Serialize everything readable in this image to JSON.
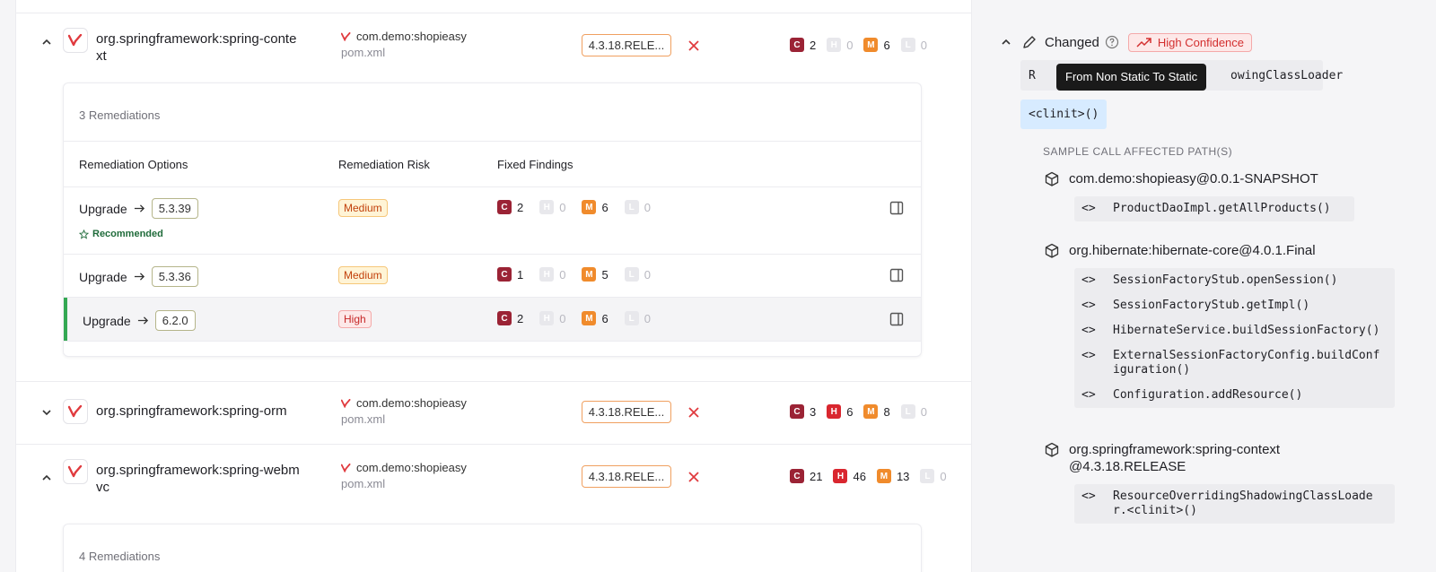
{
  "packages": [
    {
      "name_line1": "org.springframework:spring-conte",
      "name_line2": "xt",
      "project": "com.demo:shopieasy",
      "file": "pom.xml",
      "version": "4.3.18.RELE...",
      "counts": {
        "c": "2",
        "h": "0",
        "m": "6",
        "l": "0"
      }
    },
    {
      "name_line1": "org.springframework:spring-orm",
      "name_line2": "",
      "project": "com.demo:shopieasy",
      "file": "pom.xml",
      "version": "4.3.18.RELE...",
      "counts": {
        "c": "3",
        "h": "6",
        "m": "8",
        "l": "0"
      }
    },
    {
      "name_line1": "org.springframework:spring-webm",
      "name_line2": "vc",
      "project": "com.demo:shopieasy",
      "file": "pom.xml",
      "version": "4.3.18.RELE...",
      "counts": {
        "c": "21",
        "h": "46",
        "m": "13",
        "l": "0"
      }
    }
  ],
  "severity_letters": {
    "c": "C",
    "h": "H",
    "m": "M",
    "l": "L"
  },
  "remediation_card": {
    "count_label": "3 Remediations",
    "headers": {
      "options": "Remediation Options",
      "risk": "Remediation Risk",
      "fixed": "Fixed Findings"
    },
    "rows": [
      {
        "action": "Upgrade",
        "target": "5.3.39",
        "risk": "Medium",
        "recommended": "Recommended",
        "counts": {
          "c": "2",
          "h": "0",
          "m": "6",
          "l": "0"
        }
      },
      {
        "action": "Upgrade",
        "target": "5.3.36",
        "risk": "Medium",
        "counts": {
          "c": "1",
          "h": "0",
          "m": "5",
          "l": "0"
        }
      },
      {
        "action": "Upgrade",
        "target": "6.2.0",
        "risk": "High",
        "counts": {
          "c": "2",
          "h": "0",
          "m": "6",
          "l": "0"
        }
      }
    ]
  },
  "remediation_card_2": {
    "count_label": "4 Remediations"
  },
  "detail": {
    "changed_label": "Changed",
    "confidence": "High Confidence",
    "class_chip_prefix": "R",
    "class_chip_suffix": "owingClassLoader",
    "tooltip": "From Non Static To Static",
    "method_chip": "<clinit>()",
    "section_title": "SAMPLE CALL AFFECTED PATH(S)",
    "code_marker": "<>",
    "deps": [
      {
        "name": "com.demo:shopieasy@0.0.1-SNAPSHOT",
        "calls": [
          "ProductDaoImpl.getAllProducts()"
        ]
      },
      {
        "name": "org.hibernate:hibernate-core@4.0.1.Final",
        "calls": [
          "SessionFactoryStub.openSession()",
          "SessionFactoryStub.getImpl()",
          "HibernateService.buildSessionFactory()",
          "ExternalSessionFactoryConfig.buildConfiguration()",
          "Configuration.addResource()"
        ]
      },
      {
        "name": "org.springframework:spring-context@4.3.18.RELEASE",
        "calls": [
          "ResourceOverridingShadowingClassLoader.<clinit>()"
        ]
      }
    ]
  },
  "colors": {
    "critical": "#9b2335",
    "high": "#d9262f",
    "medium": "#f08b2c",
    "accent_green": "#34a853",
    "confidence_red": "#d32f2f"
  }
}
